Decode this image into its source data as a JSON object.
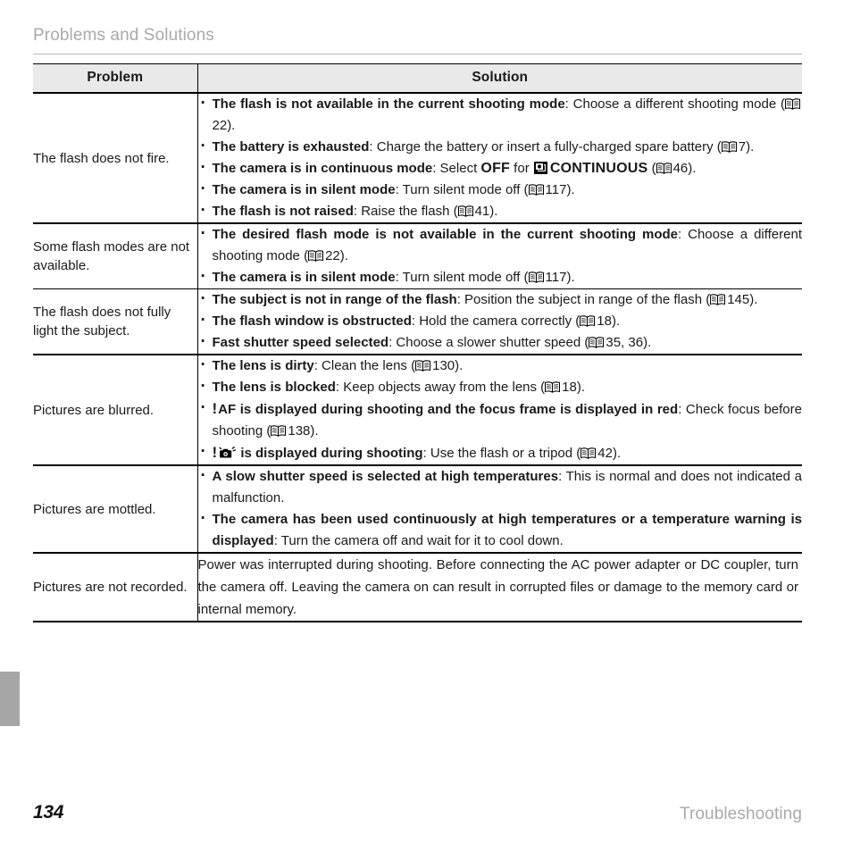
{
  "header": {
    "title": "Problems and Solutions"
  },
  "table": {
    "columns": {
      "problem": "Problem",
      "solution": "Solution"
    },
    "rows": [
      {
        "problem": "The flash does not fire.",
        "items": [
          {
            "lead": "The flash is not available in the current shooting mode",
            "rest_before_ref": ": Choose a different shooting mode (",
            "ref": "22",
            "rest_after_ref": ")."
          },
          {
            "lead": "The battery is exhausted",
            "rest_before_ref": ": Charge the battery or insert a fully-charged spare battery (",
            "ref": "7",
            "rest_after_ref": ")."
          },
          {
            "lead": "The camera is in continuous mode",
            "mid1": ": Select ",
            "caps1": "OFF",
            "mid2": " for ",
            "icon": "burst-icon",
            "caps2": "CONTINUOUS",
            "rest_before_ref": " (",
            "ref": "46",
            "rest_after_ref": ")."
          },
          {
            "lead": "The camera is in silent mode",
            "rest_before_ref": ": Turn silent mode off (",
            "ref": "117",
            "rest_after_ref": ")."
          },
          {
            "lead": "The flash is not raised",
            "rest_before_ref": ": Raise the flash (",
            "ref": "41",
            "rest_after_ref": ")."
          }
        ]
      },
      {
        "problem": "Some flash modes are not available.",
        "items": [
          {
            "lead": "The desired flash mode is not available in the current shooting mode",
            "rest_before_ref": ": Choose a different shooting mode (",
            "ref": "22",
            "rest_after_ref": ")."
          },
          {
            "lead": "The camera is in silent mode",
            "rest_before_ref": ": Turn silent mode off (",
            "ref": "117",
            "rest_after_ref": ")."
          }
        ]
      },
      {
        "problem": "The flash does not fully light the subject.",
        "items": [
          {
            "lead": "The subject is not in range of the flash",
            "rest_before_ref": ": Position the subject in range of the flash (",
            "ref": "145",
            "rest_after_ref": ")."
          },
          {
            "lead": "The flash window is obstructed",
            "rest_before_ref": ": Hold the camera correctly (",
            "ref": "18",
            "rest_after_ref": ")."
          },
          {
            "lead": "Fast shutter speed selected",
            "rest_before_ref": ": Choose a slower shutter speed (",
            "ref": "35, 36",
            "rest_after_ref": ")."
          }
        ]
      },
      {
        "problem": "Pictures are blurred.",
        "items": [
          {
            "lead": "The lens is dirty",
            "rest_before_ref": ": Clean the lens (",
            "ref": "130",
            "rest_after_ref": ")."
          },
          {
            "lead": "The lens is blocked",
            "rest_before_ref": ": Keep objects away from the lens (",
            "ref": "18",
            "rest_after_ref": ")."
          },
          {
            "exclaim": "!",
            "lead": "AF is displayed during shooting and the focus frame is displayed in red",
            "rest_before_ref": ": Check focus before shooting (",
            "ref": "138",
            "rest_after_ref": ")."
          },
          {
            "exclaim": "!",
            "icon_lead": "camera-shake-icon",
            "lead": " is displayed during shooting",
            "rest_before_ref": ": Use the flash or a tripod (",
            "ref": "42",
            "rest_after_ref": ")."
          }
        ]
      },
      {
        "problem": "Pictures are mottled.",
        "items": [
          {
            "lead": "A slow shutter speed is selected at high temperatures",
            "rest_before_ref": ": This is normal and does not indicated a malfunction.",
            "ref": "",
            "rest_after_ref": ""
          },
          {
            "lead": "The camera has been used continuously at high temperatures or a temperature warning is displayed",
            "rest_before_ref": ": Turn the camera off and wait for it to cool down.",
            "ref": "",
            "rest_after_ref": ""
          }
        ]
      },
      {
        "problem": "Pictures are not recorded.",
        "paragraph": "Power was interrupted during shooting.  Before connecting the AC power adapter or DC coupler, turn the camera off.  Leaving the camera on can result in corrupted files or damage to the memory card or internal memory."
      }
    ]
  },
  "footer": {
    "page_number": "134",
    "section": "Troubleshooting"
  }
}
